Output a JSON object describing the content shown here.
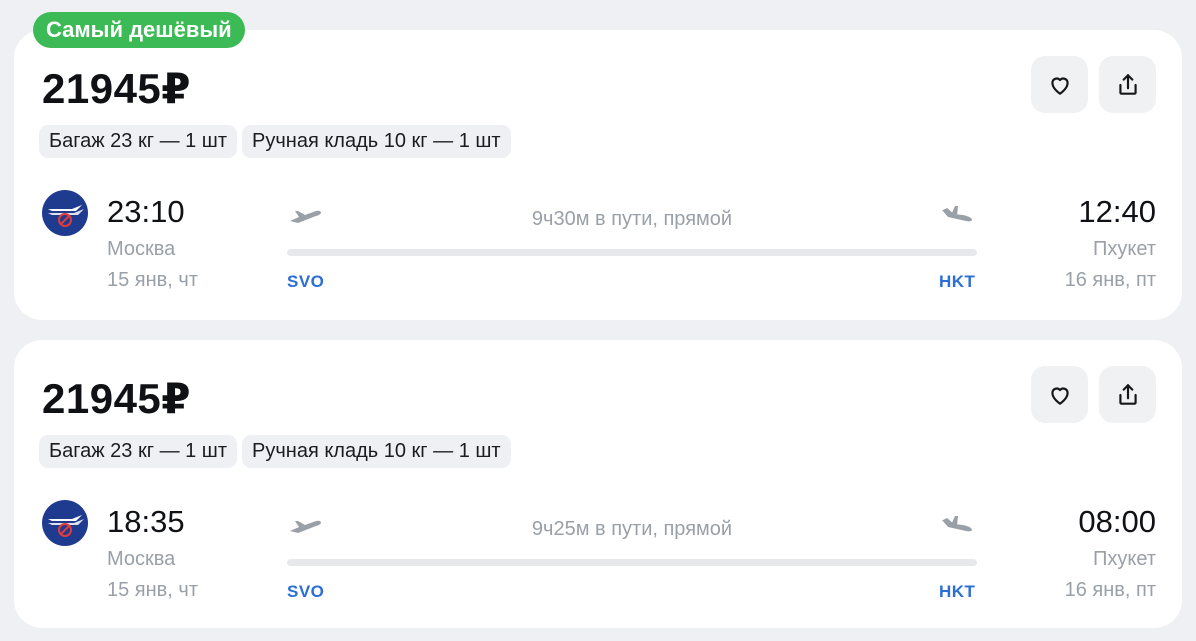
{
  "badge": "Самый дешёвый",
  "colors": {
    "badge": "#3cba55",
    "airport_code": "#2b6ed6",
    "muted_text": "#9aa0a8",
    "airline_logo": "#1f3b8f"
  },
  "offers": [
    {
      "price": "21945₽",
      "baggage": "Багаж 23 кг — 1 шт",
      "hand_luggage": "Ручная кладь 10 кг — 1 шт",
      "airline_logo_icon": "airline-logo-icon",
      "departure": {
        "time": "23:10",
        "city": "Москва",
        "date": "15 янв, чт",
        "code": "SVO"
      },
      "arrival": {
        "time": "12:40",
        "city": "Пхукет",
        "date": "16 янв, пт",
        "code": "HKT"
      },
      "duration": "9ч30м в пути, прямой"
    },
    {
      "price": "21945₽",
      "baggage": "Багаж 23 кг — 1 шт",
      "hand_luggage": "Ручная кладь 10 кг — 1 шт",
      "airline_logo_icon": "airline-logo-icon",
      "departure": {
        "time": "18:35",
        "city": "Москва",
        "date": "15 янв, чт",
        "code": "SVO"
      },
      "arrival": {
        "time": "08:00",
        "city": "Пхукет",
        "date": "16 янв, пт",
        "code": "HKT"
      },
      "duration": "9ч25м в пути, прямой"
    }
  ]
}
